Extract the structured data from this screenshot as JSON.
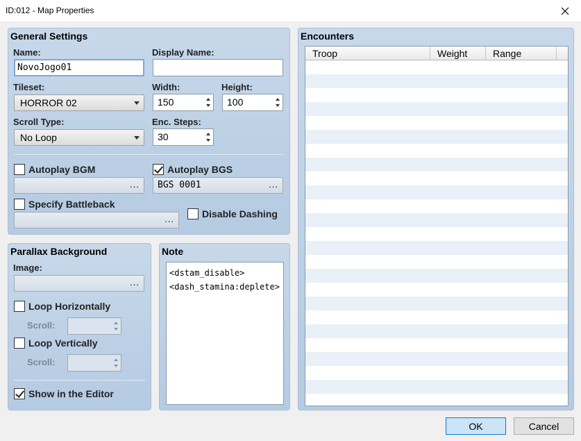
{
  "window": {
    "title": "ID:012 - Map Properties"
  },
  "general": {
    "title": "General Settings",
    "name_label": "Name:",
    "name_value": "NovoJogo01",
    "display_name_label": "Display Name:",
    "display_name_value": "",
    "tileset_label": "Tileset:",
    "tileset_value": "HORROR 02",
    "width_label": "Width:",
    "width_value": "150",
    "height_label": "Height:",
    "height_value": "100",
    "scroll_type_label": "Scroll Type:",
    "scroll_type_value": "No Loop",
    "enc_steps_label": "Enc. Steps:",
    "enc_steps_value": "30",
    "autoplay_bgm_label": "Autoplay BGM",
    "autoplay_bgm_checked": false,
    "autoplay_bgm_value": "",
    "autoplay_bgs_label": "Autoplay BGS",
    "autoplay_bgs_checked": true,
    "autoplay_bgs_value": "BGS 0001",
    "specify_battleback_label": "Specify Battleback",
    "specify_battleback_checked": false,
    "battleback_value": "",
    "disable_dashing_label": "Disable Dashing",
    "disable_dashing_checked": false,
    "browse_dots": "..."
  },
  "parallax": {
    "title": "Parallax Background",
    "image_label": "Image:",
    "image_value": "",
    "loop_h_label": "Loop Horizontally",
    "loop_h_checked": false,
    "scroll_label": "Scroll:",
    "loop_v_label": "Loop Vertically",
    "loop_v_checked": false,
    "show_in_editor_label": "Show in the Editor",
    "show_in_editor_checked": true
  },
  "note": {
    "title": "Note",
    "lines": [
      "<dstam_disable>",
      "<dash_stamina:deplete>"
    ]
  },
  "encounters": {
    "title": "Encounters",
    "columns": [
      "Troop",
      "Weight",
      "Range"
    ],
    "rows": []
  },
  "buttons": {
    "ok": "OK",
    "cancel": "Cancel"
  }
}
